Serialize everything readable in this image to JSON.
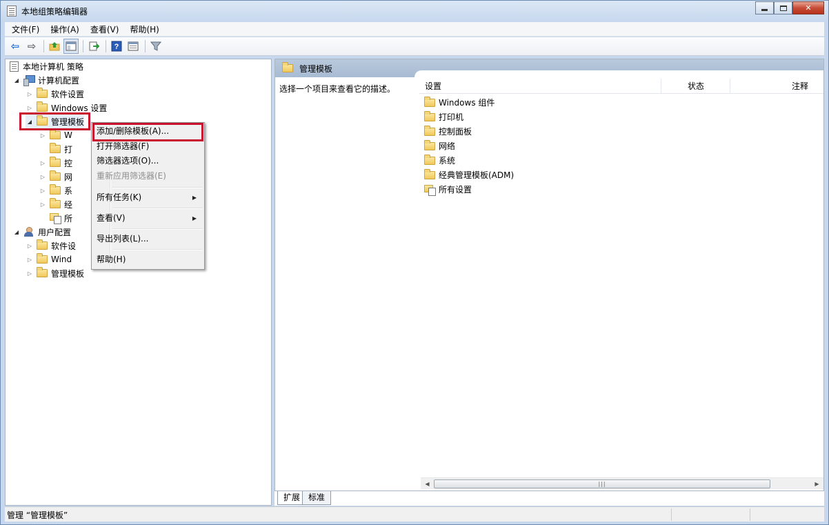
{
  "window": {
    "title": "本地组策略编辑器"
  },
  "menubar": [
    "文件(F)",
    "操作(A)",
    "查看(V)",
    "帮助(H)"
  ],
  "tree": {
    "root": "本地计算机 策略",
    "computer_config": "计算机配置",
    "software_settings": "软件设置",
    "windows_settings": "Windows 设置",
    "admin_templates": "管理模板",
    "admin_children": [
      "W",
      "打",
      "控",
      "网",
      "系",
      "经",
      "所"
    ],
    "user_config": "用户配置",
    "user_software": "软件设",
    "user_windows": "Wind",
    "user_admin": "管理模板"
  },
  "context_menu": {
    "items": [
      {
        "label": "添加/删除模板(A)...",
        "disabled": false
      },
      {
        "label": "打开筛选器(F)",
        "disabled": false
      },
      {
        "label": "筛选器选项(O)...",
        "disabled": false
      },
      {
        "label": "重新应用筛选器(E)",
        "disabled": true
      },
      {
        "label": "所有任务(K)",
        "disabled": false,
        "submenu": true
      },
      {
        "label": "查看(V)",
        "disabled": false,
        "submenu": true
      },
      {
        "label": "导出列表(L)...",
        "disabled": false
      },
      {
        "label": "帮助(H)",
        "disabled": false
      }
    ]
  },
  "right_pane": {
    "header_title": "管理模板",
    "description": "选择一个项目来查看它的描述。",
    "columns": [
      "设置",
      "状态",
      "注释"
    ],
    "items": [
      "Windows 组件",
      "打印机",
      "控制面板",
      "网络",
      "系统",
      "经典管理模板(ADM)",
      "所有设置"
    ]
  },
  "tabs": [
    "扩展",
    "标准"
  ],
  "status": {
    "text": "管理 “管理模板”"
  },
  "colors": {
    "highlight": "#c8102e",
    "header": "#a7bbd3"
  }
}
